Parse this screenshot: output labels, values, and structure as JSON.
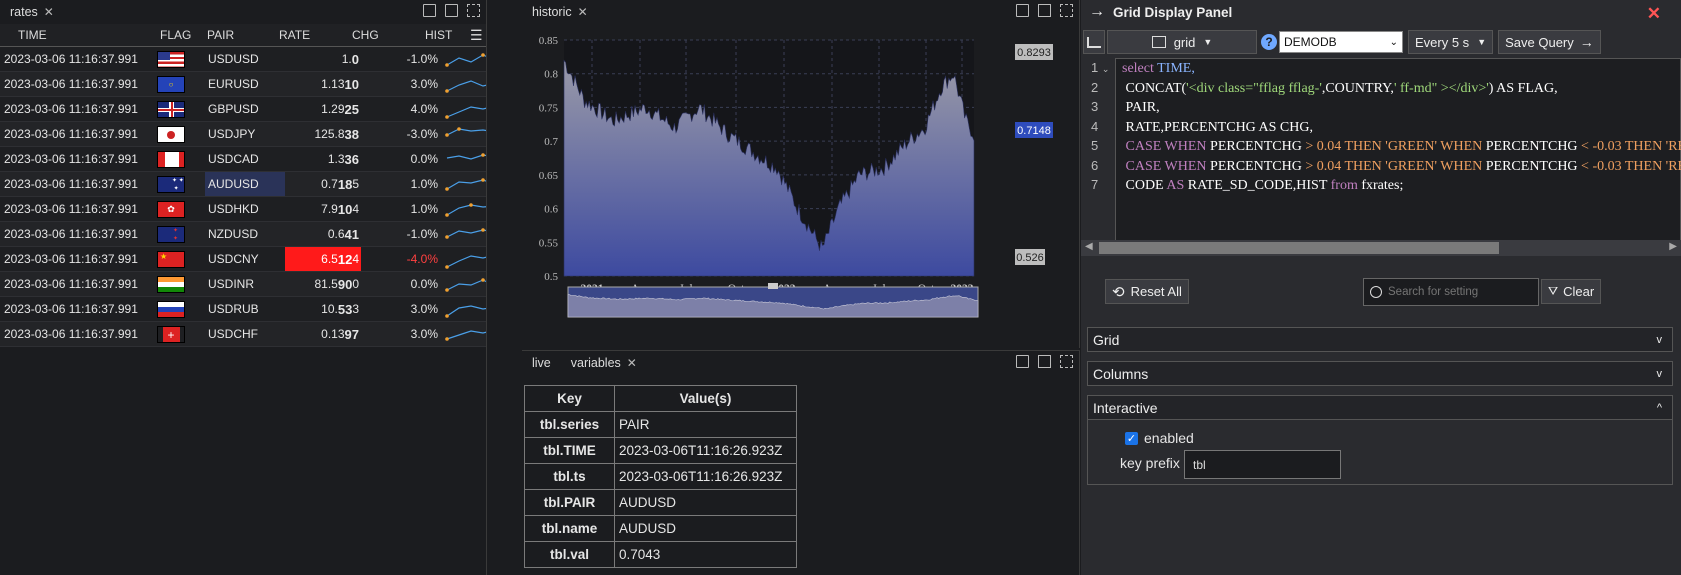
{
  "rates": {
    "tab": "rates",
    "columns": [
      "TIME",
      "FLAG",
      "PAIR",
      "RATE",
      "CHG",
      "HIST"
    ],
    "rows": [
      {
        "time": "2023-03-06 11:16:37.991",
        "flag": "us",
        "pair": "USDUSD",
        "rate_a": "1.",
        "rate_b": "0",
        "rate_c": "",
        "chg": "-1.0%",
        "hist": [
          5,
          12,
          8,
          15,
          10,
          14,
          7
        ]
      },
      {
        "time": "2023-03-06 11:16:37.991",
        "flag": "eu",
        "pair": "EURUSD",
        "rate_a": "1.13",
        "rate_b": "10",
        "rate_c": "",
        "chg": "3.0%",
        "hist": [
          4,
          10,
          14,
          9,
          12,
          15,
          11
        ]
      },
      {
        "time": "2023-03-06 11:16:37.991",
        "flag": "gb",
        "pair": "GBPUSD",
        "rate_a": "1.29",
        "rate_b": "25",
        "rate_c": "",
        "chg": "4.0%",
        "hist": [
          3,
          8,
          13,
          11,
          14,
          10,
          12
        ]
      },
      {
        "time": "2023-03-06 11:16:37.991",
        "flag": "jp",
        "pair": "USDJPY",
        "rate_a": "125.8",
        "rate_b": "38",
        "rate_c": "",
        "chg": "-3.0%",
        "hist": [
          10,
          16,
          14,
          15,
          13,
          12,
          14
        ]
      },
      {
        "time": "2023-03-06 11:16:37.991",
        "flag": "ca",
        "pair": "USDCAD",
        "rate_a": "1.3",
        "rate_b": "36",
        "rate_c": "",
        "chg": "0.0%",
        "hist": [
          12,
          14,
          11,
          15,
          13,
          12,
          10
        ]
      },
      {
        "time": "2023-03-06 11:16:37.991",
        "flag": "au",
        "pair": "AUDUSD",
        "rate_a": "0.7",
        "rate_b": "18",
        "rate_c": "5",
        "chg": "1.0%",
        "hist": [
          6,
          13,
          12,
          15,
          11,
          13,
          12
        ]
      },
      {
        "time": "2023-03-06 11:16:37.991",
        "flag": "hk",
        "pair": "USDHKD",
        "rate_a": "7.9",
        "rate_b": "10",
        "rate_c": "4",
        "chg": "1.0%",
        "hist": [
          5,
          12,
          15,
          13,
          14,
          12,
          13
        ]
      },
      {
        "time": "2023-03-06 11:16:37.991",
        "flag": "nz",
        "pair": "NZDUSD",
        "rate_a": "0.6",
        "rate_b": "41",
        "rate_c": "",
        "chg": "-1.0%",
        "hist": [
          8,
          14,
          12,
          15,
          13,
          11,
          12
        ]
      },
      {
        "time": "2023-03-06 11:16:37.991",
        "flag": "cn",
        "pair": "USDCNY",
        "rate_a": "6.5",
        "rate_b": "12",
        "rate_c": "4",
        "chg": "-4.0%",
        "hist": [
          3,
          9,
          14,
          12,
          15,
          11,
          13
        ]
      },
      {
        "time": "2023-03-06 11:16:37.991",
        "flag": "in",
        "pair": "USDINR",
        "rate_a": "81.5",
        "rate_b": "90",
        "rate_c": "0",
        "chg": "0.0%",
        "hist": [
          5,
          11,
          10,
          15,
          9,
          12,
          8
        ]
      },
      {
        "time": "2023-03-06 11:16:37.991",
        "flag": "ru",
        "pair": "USDRUB",
        "rate_a": "10.",
        "rate_b": "53",
        "rate_c": "3",
        "chg": "3.0%",
        "hist": [
          4,
          12,
          14,
          11,
          13,
          15,
          12
        ]
      },
      {
        "time": "2023-03-06 11:16:37.991",
        "flag": "ch",
        "pair": "USDCHF",
        "rate_a": "0.13",
        "rate_b": "97",
        "rate_c": "",
        "chg": "3.0%",
        "hist": [
          6,
          10,
          14,
          12,
          15,
          13,
          14
        ]
      }
    ]
  },
  "historic": {
    "tab": "historic",
    "ylabels": [
      "0.85",
      "0.8",
      "0.75",
      "0.7",
      "0.65",
      "0.6",
      "0.55",
      "0.5"
    ],
    "xlabels": [
      "2021",
      "Apr",
      "Jul",
      "Oct",
      "2022",
      "Apr",
      "Jul",
      "Oct",
      "2023"
    ],
    "markers": {
      "high": "0.8293",
      "current": "0.7148",
      "low": "0.526"
    }
  },
  "live": {
    "tabs": [
      "live",
      "variables"
    ],
    "headers": [
      "Key",
      "Value(s)"
    ],
    "rows": [
      {
        "k": "tbl.series",
        "v": "PAIR"
      },
      {
        "k": "tbl.TIME",
        "v": "2023-03-06T11:16:26.923Z"
      },
      {
        "k": "tbl.ts",
        "v": "2023-03-06T11:16:26.923Z"
      },
      {
        "k": "tbl.PAIR",
        "v": "AUDUSD"
      },
      {
        "k": "tbl.name",
        "v": "AUDUSD"
      },
      {
        "k": "tbl.val",
        "v": "0.7043"
      }
    ]
  },
  "gdp": {
    "title": "Grid Display Panel",
    "chart_type": "grid",
    "db": "DEMODB",
    "refresh": "Every 5 s",
    "save": "Save Query",
    "code": {
      "l1_kw": "select",
      "l1_id": "TIME,",
      "l2_a": "CONCAT(",
      "l2_s": "'<div class=\"fflag fflag-'",
      "l2_b": ",COUNTRY,",
      "l2_s2": "' ff-md\" ></div>'",
      "l2_c": ") AS FLAG,",
      "l3": "PAIR,",
      "l4": "RATE,PERCENTCHG AS CHG,",
      "l5_a": "CASE WHEN",
      "l5_b": "PERCENTCHG",
      "l5_c": "> 0.04 THEN 'GREEN' WHEN",
      "l5_d": "PERCENTCHG",
      "l5_e": "< -0.03 THEN 'RE",
      "l6_a": "CASE WHEN",
      "l6_b": "PERCENTCHG",
      "l6_c": "> 0.04 THEN 'GREEN' WHEN",
      "l6_d": "PERCENTCHG",
      "l6_e": "< -0.03 THEN 'RE",
      "l7_a": "CODE",
      "l7_b": "AS",
      "l7_c": "RATE_SD_CODE,HIST",
      "l7_d": "from",
      "l7_e": "fxrates;"
    },
    "line_numbers": [
      "1",
      "2",
      "3",
      "4",
      "5",
      "6",
      "7"
    ],
    "reset_all": "Reset All",
    "search_placeholder": "Search for setting",
    "clear": "Clear",
    "sections": [
      "Grid",
      "Columns",
      "Interactive"
    ],
    "enabled_label": "enabled",
    "key_prefix_label": "key prefix",
    "key_prefix_value": "tbl"
  }
}
